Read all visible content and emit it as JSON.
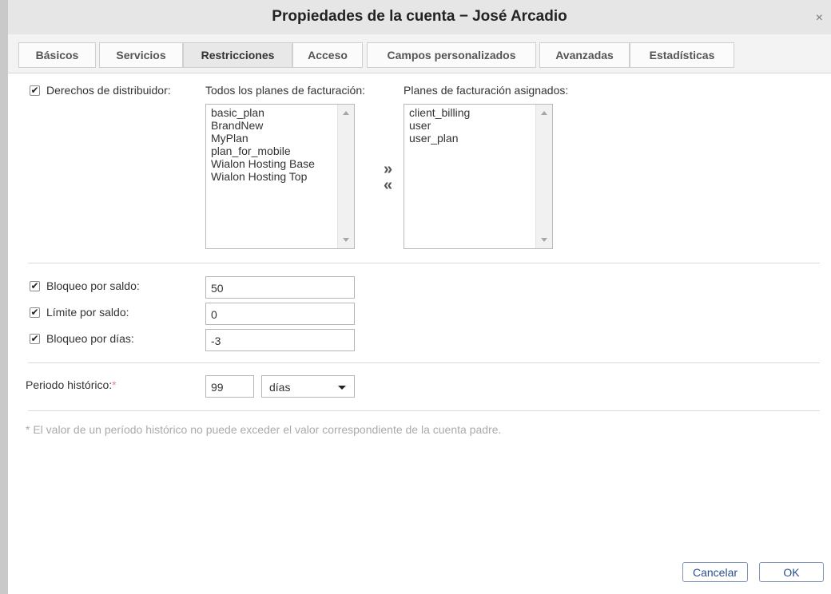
{
  "window": {
    "title": "Propiedades de la cuenta − José Arcadio",
    "close_glyph": "×"
  },
  "tabs": [
    {
      "label": "Básicos",
      "active": false
    },
    {
      "label": "Servicios",
      "active": false
    },
    {
      "label": "Restricciones",
      "active": true
    },
    {
      "label": "Acceso",
      "active": false
    },
    {
      "label": "Campos personalizados",
      "active": false
    },
    {
      "label": "Avanzadas",
      "active": false
    },
    {
      "label": "Estadísticas",
      "active": false
    }
  ],
  "dealer": {
    "checked": true,
    "label": "Derechos de distribuidor:",
    "all_plans_label": "Todos los planes de facturación:",
    "all_plans": [
      "basic_plan",
      "BrandNew",
      "MyPlan",
      "plan_for_mobile",
      "Wialon Hosting Base",
      "Wialon Hosting Top"
    ],
    "assigned_label": "Planes de facturación asignados:",
    "assigned_plans": [
      "client_billing",
      "user",
      "user_plan"
    ],
    "add_glyph": "»",
    "remove_glyph": "«"
  },
  "limits": [
    {
      "label": "Bloqueo por saldo:",
      "checked": true,
      "value": "50"
    },
    {
      "label": "Límite por saldo:",
      "checked": true,
      "value": "0"
    },
    {
      "label": "Bloqueo por días:",
      "checked": true,
      "value": "-3"
    }
  ],
  "history": {
    "label": "Periodo histórico:",
    "required_mark": "*",
    "value": "99",
    "unit": "días"
  },
  "note": "* El valor de un período histórico no puede exceder el valor correspondiente de la cuenta padre.",
  "buttons": {
    "cancel": "Cancelar",
    "ok": "OK"
  },
  "colors": {
    "accent": "#2b4f8a",
    "required": "#f08080",
    "note": "#aaaaaa"
  }
}
